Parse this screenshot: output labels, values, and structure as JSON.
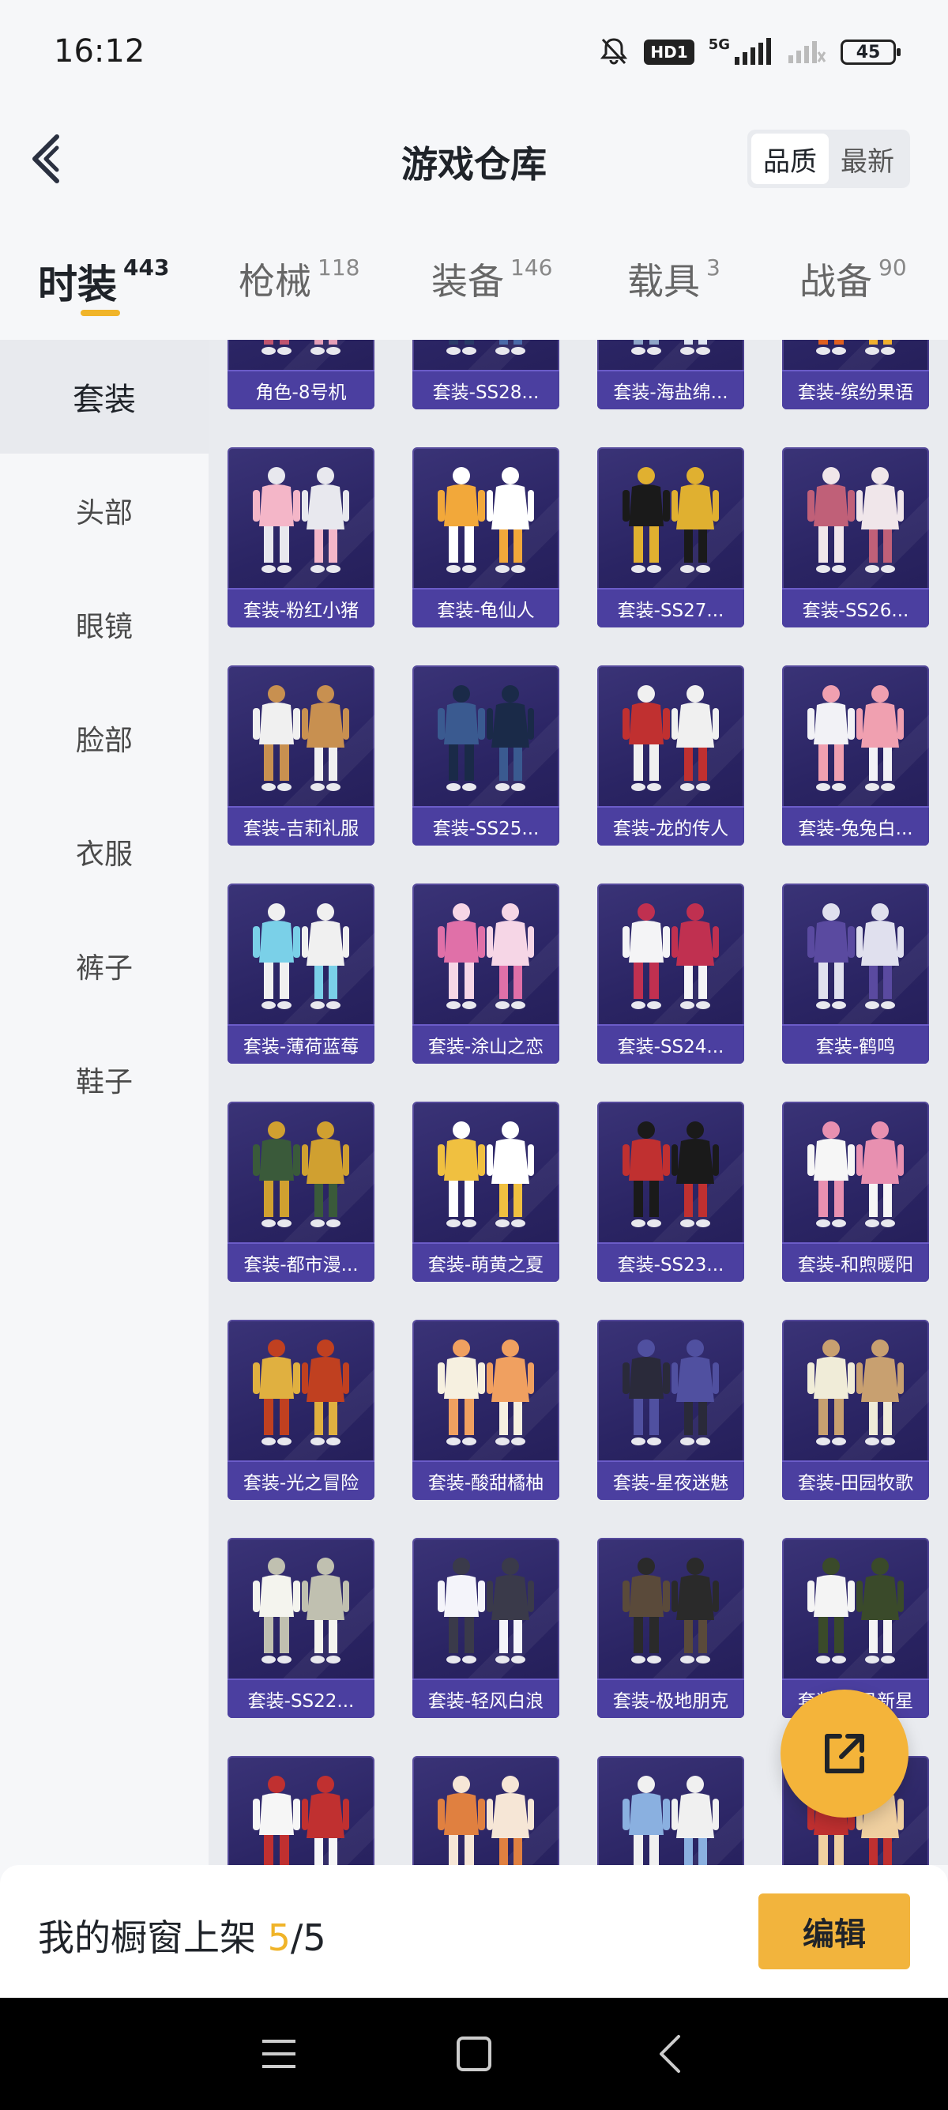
{
  "status_bar": {
    "time": "16:12",
    "hd_label": "HD1",
    "network": "5G",
    "battery": "45"
  },
  "header": {
    "title": "游戏仓库",
    "sort_options": [
      "品质",
      "最新"
    ],
    "sort_active": 0
  },
  "tabs": [
    {
      "label": "时装",
      "count": "443",
      "active": true
    },
    {
      "label": "枪械",
      "count": "118",
      "active": false
    },
    {
      "label": "装备",
      "count": "146",
      "active": false
    },
    {
      "label": "载具",
      "count": "3",
      "active": false
    },
    {
      "label": "战备",
      "count": "90",
      "active": false
    }
  ],
  "sidebar": {
    "items": [
      {
        "label": "套装",
        "active": true
      },
      {
        "label": "头部",
        "active": false
      },
      {
        "label": "眼镜",
        "active": false
      },
      {
        "label": "脸部",
        "active": false
      },
      {
        "label": "衣服",
        "active": false
      },
      {
        "label": "裤子",
        "active": false
      },
      {
        "label": "鞋子",
        "active": false
      }
    ]
  },
  "items": [
    {
      "name": "角色-8号机",
      "palette": [
        "#e6a0b8",
        "#c0556f"
      ]
    },
    {
      "name": "套装-SS28...",
      "palette": [
        "#4a6aa8",
        "#2a3a68"
      ]
    },
    {
      "name": "套装-海盐绵...",
      "palette": [
        "#dfe6f2",
        "#8fa6c8"
      ]
    },
    {
      "name": "套装-缤纷果语",
      "palette": [
        "#f0b030",
        "#e06020"
      ]
    },
    {
      "name": "套装-粉红小猪",
      "palette": [
        "#f4b6c8",
        "#e8e8ee"
      ]
    },
    {
      "name": "套装-龟仙人",
      "palette": [
        "#f2a83a",
        "#ffffff"
      ]
    },
    {
      "name": "套装-SS27...",
      "palette": [
        "#1a1a1a",
        "#e0b030"
      ]
    },
    {
      "name": "套装-SS26...",
      "palette": [
        "#c06078",
        "#f0e6ea"
      ]
    },
    {
      "name": "套装-吉莉礼服",
      "palette": [
        "#f0f0f0",
        "#c89050"
      ]
    },
    {
      "name": "套装-SS25...",
      "palette": [
        "#3a5a90",
        "#1a2a48"
      ]
    },
    {
      "name": "套装-龙的传人",
      "palette": [
        "#c03030",
        "#f0f0f0"
      ]
    },
    {
      "name": "套装-兔兔白...",
      "palette": [
        "#f2f2f6",
        "#f0a0b0"
      ]
    },
    {
      "name": "套装-薄荷蓝莓",
      "palette": [
        "#7ad0e8",
        "#f0f0f0"
      ]
    },
    {
      "name": "套装-涂山之恋",
      "palette": [
        "#e070a8",
        "#f6d6e6"
      ]
    },
    {
      "name": "套装-SS24...",
      "palette": [
        "#f4f4f6",
        "#c03050"
      ]
    },
    {
      "name": "套装-鹤鸣",
      "palette": [
        "#5a4aa0",
        "#e0e0ee"
      ]
    },
    {
      "name": "套装-都市漫...",
      "palette": [
        "#3a5a3a",
        "#d0a030"
      ]
    },
    {
      "name": "套装-萌黄之夏",
      "palette": [
        "#f0c040",
        "#ffffff"
      ]
    },
    {
      "name": "套装-SS23...",
      "palette": [
        "#c03030",
        "#1a1a1a"
      ]
    },
    {
      "name": "套装-和煦暖阳",
      "palette": [
        "#f6f6f6",
        "#e890b0"
      ]
    },
    {
      "name": "套装-光之冒险",
      "palette": [
        "#e0b040",
        "#c04020"
      ]
    },
    {
      "name": "套装-酸甜橘柚",
      "palette": [
        "#f6f0e0",
        "#f0a060"
      ]
    },
    {
      "name": "套装-星夜迷魅",
      "palette": [
        "#2a2a3a",
        "#5050a0"
      ]
    },
    {
      "name": "套装-田园牧歌",
      "palette": [
        "#f0ecd8",
        "#c8a070"
      ]
    },
    {
      "name": "套装-SS22...",
      "palette": [
        "#f4f4ee",
        "#c0c0b0"
      ]
    },
    {
      "name": "套装-轻风白浪",
      "palette": [
        "#f4f4fa",
        "#3a3a4a"
      ]
    },
    {
      "name": "套装-极地朋克",
      "palette": [
        "#5a4a3a",
        "#2a2a2a"
      ]
    },
    {
      "name": "套装-明日新星",
      "palette": [
        "#f4f4f4",
        "#3a4a2a"
      ]
    },
    {
      "name": "",
      "palette": [
        "#f6f6f6",
        "#c03030"
      ]
    },
    {
      "name": "",
      "palette": [
        "#e08040",
        "#f6e6d6"
      ]
    },
    {
      "name": "",
      "palette": [
        "#8ab0e0",
        "#f0f0f0"
      ]
    },
    {
      "name": "",
      "palette": [
        "#c03030",
        "#f0d0a0"
      ]
    }
  ],
  "bottom_bar": {
    "label": "我的橱窗上架 ",
    "used": "5",
    "separator": "/",
    "total": "5",
    "edit_label": "编辑"
  },
  "colors": {
    "accent": "#f0b429",
    "card_bg": "#2a2463",
    "card_label_bg": "#4b3fa0"
  }
}
